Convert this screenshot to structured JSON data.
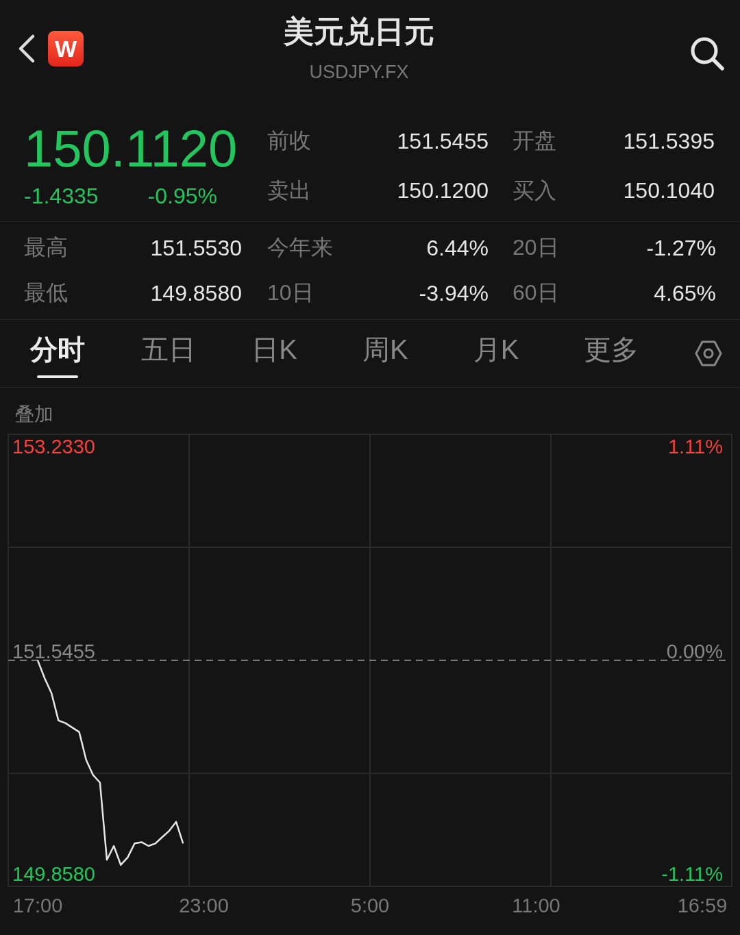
{
  "header": {
    "logo_letter": "W",
    "title": "美元兑日元",
    "symbol": "USDJPY.FX"
  },
  "quote": {
    "price": "150.1120",
    "change": "-1.4335",
    "change_pct": "-0.95%",
    "fields": [
      {
        "label": "前收",
        "value": "151.5455"
      },
      {
        "label": "开盘",
        "value": "151.5395"
      },
      {
        "label": "卖出",
        "value": "150.1200"
      },
      {
        "label": "买入",
        "value": "150.1040"
      }
    ]
  },
  "stats": [
    {
      "label": "最高",
      "value": "151.5530"
    },
    {
      "label": "今年来",
      "value": "6.44%"
    },
    {
      "label": "20日",
      "value": "-1.27%"
    },
    {
      "label": "最低",
      "value": "149.8580"
    },
    {
      "label": "10日",
      "value": "-3.94%"
    },
    {
      "label": "60日",
      "value": "4.65%"
    }
  ],
  "tabs": [
    {
      "label": "分时",
      "selected": true
    },
    {
      "label": "五日",
      "selected": false
    },
    {
      "label": "日K",
      "selected": false
    },
    {
      "label": "周K",
      "selected": false
    },
    {
      "label": "月K",
      "selected": false
    },
    {
      "label": "更多",
      "selected": false
    }
  ],
  "overlay_label": "叠加",
  "chart": {
    "chart_data": {
      "type": "line",
      "categories": [
        "17:00",
        null,
        null,
        null,
        null,
        null,
        null,
        null,
        null,
        null,
        null,
        null,
        null,
        null,
        null,
        null,
        null,
        null,
        null,
        null,
        null,
        null,
        null,
        null,
        "23:00",
        null,
        null,
        null,
        null,
        null,
        null,
        null,
        null,
        null,
        null,
        null,
        null,
        null,
        null,
        null,
        null,
        null,
        null,
        null,
        null,
        null,
        null,
        null,
        "5:00",
        null,
        null,
        null,
        null,
        null,
        null,
        null,
        null,
        null,
        null,
        null,
        null,
        null,
        null,
        null,
        null,
        null,
        null,
        null,
        null,
        null,
        null,
        null,
        "11:00",
        null,
        null,
        null,
        null,
        null,
        null,
        null,
        null,
        null,
        null,
        null,
        null,
        null,
        null,
        null,
        null,
        null,
        null,
        null,
        null,
        null,
        null,
        null,
        "16:59"
      ],
      "series": [
        {
          "color": "#e6e6e6",
          "values": [
            151.546,
            151.405,
            151.286,
            151.07,
            151.05,
            151.015,
            150.98,
            150.76,
            150.64,
            150.58,
            149.97,
            150.08,
            149.93,
            149.99,
            150.1,
            150.11,
            150.08,
            150.1,
            150.15,
            150.2,
            150.27,
            150.1,
            null,
            null,
            null,
            null,
            null,
            null,
            null,
            null,
            null,
            null,
            null,
            null,
            null,
            null,
            null,
            null,
            null,
            null,
            null,
            null,
            null,
            null,
            null,
            null,
            null,
            null,
            null,
            null,
            null,
            null,
            null,
            null,
            null,
            null,
            null,
            null,
            null,
            null,
            null,
            null,
            null,
            null,
            null,
            null,
            null,
            null,
            null,
            null,
            null,
            null,
            null,
            null,
            null,
            null,
            null,
            null,
            null,
            null,
            null,
            null,
            null,
            null,
            null,
            null,
            null,
            null,
            null,
            null,
            null,
            null,
            null,
            null,
            null,
            null,
            null
          ]
        }
      ],
      "ylim": [
        149.7607,
        153.3303
      ],
      "y2lim": [
        -1.174,
        1.174
      ],
      "yticks": [
        {
          "value": 153.233,
          "label": "153.2330"
        },
        {
          "value": 151.5455,
          "label": "151.5455"
        },
        {
          "value": 149.858,
          "label": "149.8580"
        }
      ],
      "y2ticks": [
        {
          "value": 1.11,
          "label": "1.11%"
        },
        {
          "value": 0,
          "label": "0.00%"
        },
        {
          "value": -1.11,
          "label": "-1.11%"
        }
      ],
      "ref_lines": [
        {
          "axis": "y",
          "value": 151.5455
        }
      ]
    }
  }
}
